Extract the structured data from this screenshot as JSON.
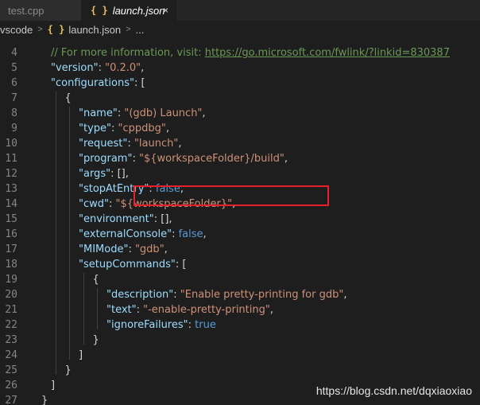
{
  "tabs": [
    {
      "label": "test.cpp",
      "active": false
    },
    {
      "label": "launch.json",
      "active": true,
      "icon": "{ }",
      "close": "×"
    }
  ],
  "breadcrumb": {
    "folder": "vscode",
    "separator": ">",
    "icon": "{ }",
    "file": "launch.json",
    "more": "..."
  },
  "editor": {
    "line_numbers": [
      "4",
      "5",
      "6",
      "7",
      "8",
      "9",
      "10",
      "11",
      "12",
      "13",
      "14",
      "15",
      "16",
      "17",
      "18",
      "19",
      "20",
      "21",
      "22",
      "23",
      "24",
      "25",
      "26",
      "27"
    ],
    "lines": [
      [
        {
          "t": "// For more information, visit: ",
          "c": "cmt"
        },
        {
          "t": "https://go.microsoft.com/fwlink/?linkid=830387",
          "c": "cmt",
          "u": true
        }
      ],
      [
        {
          "t": "\"version\"",
          "c": "key"
        },
        {
          "t": ": ",
          "c": "punc"
        },
        {
          "t": "\"0.2.0\"",
          "c": "str"
        },
        {
          "t": ",",
          "c": "punc"
        }
      ],
      [
        {
          "t": "\"configurations\"",
          "c": "key"
        },
        {
          "t": ": [",
          "c": "punc"
        }
      ],
      [
        {
          "t": "{",
          "c": "punc"
        }
      ],
      [
        {
          "t": "\"name\"",
          "c": "key"
        },
        {
          "t": ": ",
          "c": "punc"
        },
        {
          "t": "\"(gdb) Launch\"",
          "c": "str"
        },
        {
          "t": ",",
          "c": "punc"
        }
      ],
      [
        {
          "t": "\"type\"",
          "c": "key"
        },
        {
          "t": ": ",
          "c": "punc"
        },
        {
          "t": "\"cppdbg\"",
          "c": "str"
        },
        {
          "t": ",",
          "c": "punc"
        }
      ],
      [
        {
          "t": "\"request\"",
          "c": "key"
        },
        {
          "t": ": ",
          "c": "punc"
        },
        {
          "t": "\"launch\"",
          "c": "str"
        },
        {
          "t": ",",
          "c": "punc"
        }
      ],
      [
        {
          "t": "\"program\"",
          "c": "key"
        },
        {
          "t": ": ",
          "c": "punc"
        },
        {
          "t": "\"${workspaceFolder}/build\"",
          "c": "str"
        },
        {
          "t": ",",
          "c": "punc"
        }
      ],
      [
        {
          "t": "\"args\"",
          "c": "key"
        },
        {
          "t": ": [],",
          "c": "punc"
        }
      ],
      [
        {
          "t": "\"stopAtEntry\"",
          "c": "key"
        },
        {
          "t": ": ",
          "c": "punc"
        },
        {
          "t": "false",
          "c": "kw"
        },
        {
          "t": ",",
          "c": "punc"
        }
      ],
      [
        {
          "t": "\"cwd\"",
          "c": "key"
        },
        {
          "t": ": ",
          "c": "punc"
        },
        {
          "t": "\"${workspaceFolder}\"",
          "c": "str"
        },
        {
          "t": ",",
          "c": "punc"
        }
      ],
      [
        {
          "t": "\"environment\"",
          "c": "key"
        },
        {
          "t": ": [],",
          "c": "punc"
        }
      ],
      [
        {
          "t": "\"externalConsole\"",
          "c": "key"
        },
        {
          "t": ": ",
          "c": "punc"
        },
        {
          "t": "false",
          "c": "kw"
        },
        {
          "t": ",",
          "c": "punc"
        }
      ],
      [
        {
          "t": "\"MIMode\"",
          "c": "key"
        },
        {
          "t": ": ",
          "c": "punc"
        },
        {
          "t": "\"gdb\"",
          "c": "str"
        },
        {
          "t": ",",
          "c": "punc"
        }
      ],
      [
        {
          "t": "\"setupCommands\"",
          "c": "key"
        },
        {
          "t": ": [",
          "c": "punc"
        }
      ],
      [
        {
          "t": "{",
          "c": "punc"
        }
      ],
      [
        {
          "t": "\"description\"",
          "c": "key"
        },
        {
          "t": ": ",
          "c": "punc"
        },
        {
          "t": "\"Enable pretty-printing for gdb\"",
          "c": "str"
        },
        {
          "t": ",",
          "c": "punc"
        }
      ],
      [
        {
          "t": "\"text\"",
          "c": "key"
        },
        {
          "t": ": ",
          "c": "punc"
        },
        {
          "t": "\"-enable-pretty-printing\"",
          "c": "str"
        },
        {
          "t": ",",
          "c": "punc"
        }
      ],
      [
        {
          "t": "\"ignoreFailures\"",
          "c": "key"
        },
        {
          "t": ": ",
          "c": "punc"
        },
        {
          "t": "true",
          "c": "kw"
        }
      ],
      [
        {
          "t": "}",
          "c": "punc"
        }
      ],
      [
        {
          "t": "]",
          "c": "punc"
        }
      ],
      [
        {
          "t": "}",
          "c": "punc"
        }
      ],
      [
        {
          "t": "]",
          "c": "punc"
        }
      ],
      [
        {
          "t": "}",
          "c": "punc"
        }
      ]
    ]
  },
  "watermark": "https://blog.csdn.net/dqxiaoxiao",
  "colors": {
    "key": "#9cdcfe",
    "string": "#ce9178",
    "keyword": "#569cd6",
    "comment": "#6a9955",
    "highlight_box": "#e8202a"
  }
}
